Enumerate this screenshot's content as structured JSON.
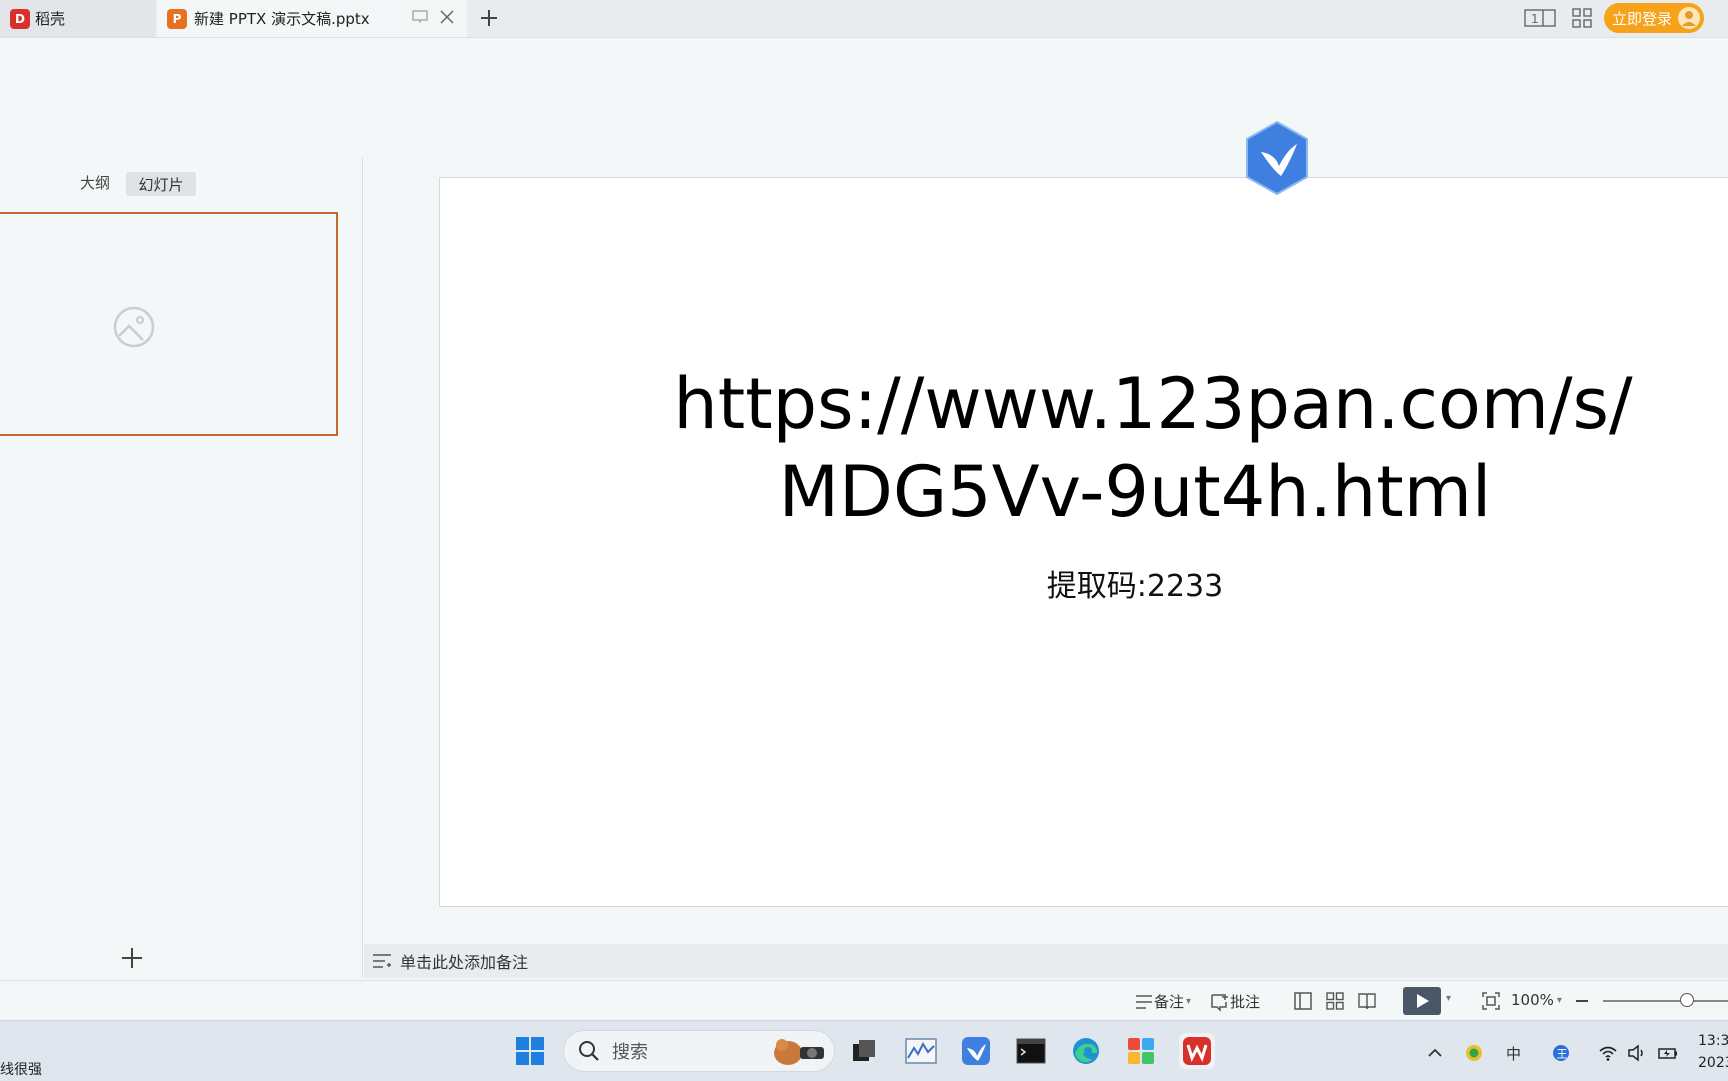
{
  "tabs": {
    "home": {
      "label": "稻壳",
      "badge": "D",
      "badge_color": "#d9302c"
    },
    "document": {
      "label": "新建 PPTX 演示文稿.pptx",
      "badge": "P",
      "badge_color": "#e8701e"
    }
  },
  "header": {
    "login_label": "立即登录"
  },
  "left_panel": {
    "view_outline": "大纲",
    "view_slides": "幻灯片"
  },
  "slide": {
    "url_line1": "https://www.123pan.com/s/",
    "url_line2": "MDG5Vv-9ut4h.html",
    "code_text": "提取码:2233"
  },
  "notes": {
    "placeholder": "单击此处添加备注"
  },
  "statusbar": {
    "notes_label": "备注",
    "comment_label": "批注",
    "zoom_label": "100%"
  },
  "taskbar": {
    "status_text": "线很强",
    "search_placeholder": "搜索",
    "clock_time": "13:3",
    "clock_date": "2023"
  },
  "colors": {
    "accent_orange": "#f7a21b",
    "selection_border": "#c46a32",
    "wps_red": "#d9302c"
  },
  "icons": [
    "home-app-icon",
    "ppt-app-icon",
    "pin-icon",
    "close-icon",
    "plus-icon",
    "layout-icon",
    "apps-grid-icon",
    "avatar-icon",
    "image-placeholder-icon",
    "bird-icon",
    "notes-lines-icon",
    "comment-icon",
    "normal-view-icon",
    "sorter-view-icon",
    "reading-view-icon",
    "play-icon",
    "fit-icon",
    "zoom-out-icon",
    "windows-start-icon",
    "search-icon",
    "wifi-icon",
    "volume-icon",
    "battery-icon"
  ]
}
